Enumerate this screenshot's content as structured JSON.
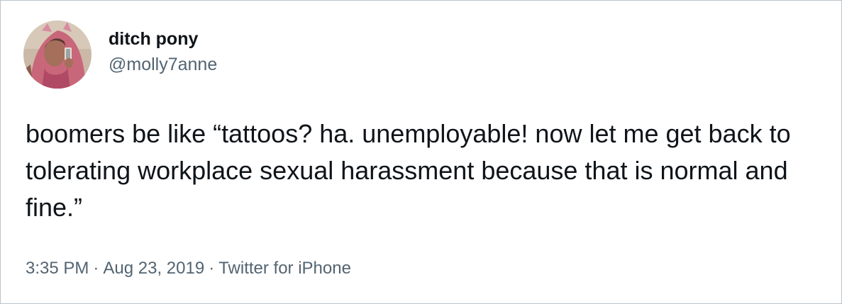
{
  "tweet": {
    "author": {
      "display_name": "ditch pony",
      "handle": "@molly7anne",
      "avatar_icon": "profile-photo"
    },
    "text": "boomers be like “tattoos? ha. unemployable! now let me get back to tolerating workplace sexual harassment because that is normal and fine.”",
    "meta": {
      "time": "3:35 PM",
      "separator": "·",
      "date": "Aug 23, 2019",
      "source": "Twitter for iPhone"
    }
  },
  "colors": {
    "text_primary": "#0f1419",
    "text_secondary": "#536471",
    "border": "#b9c4cc"
  }
}
